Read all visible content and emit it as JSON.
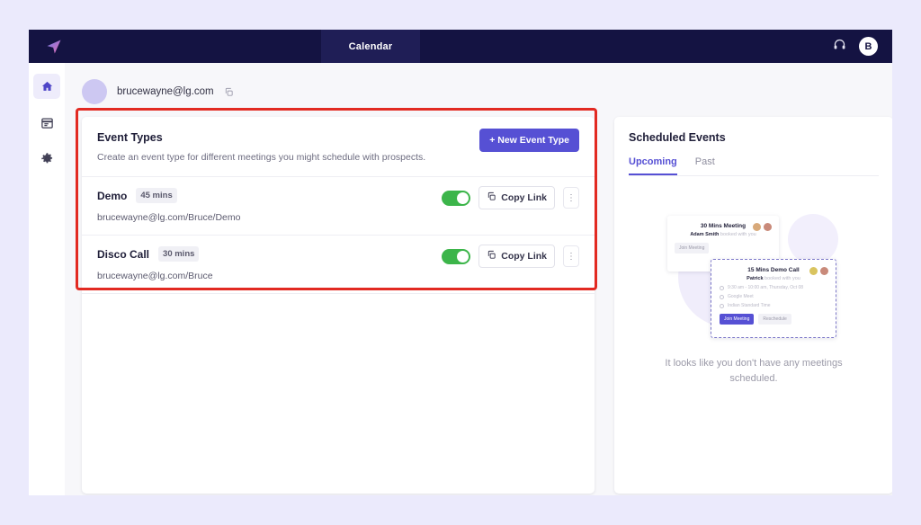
{
  "navbar": {
    "logo_icon": "paper-plane-logo",
    "tabs": [
      {
        "label": "Calendar",
        "active": true
      }
    ],
    "support_icon": "headphones-icon",
    "avatar_initial": "B"
  },
  "sidebar": {
    "items": [
      {
        "icon": "home-icon",
        "active": true
      },
      {
        "icon": "calendar-icon",
        "active": false
      },
      {
        "icon": "gear-icon",
        "active": false
      }
    ]
  },
  "account": {
    "email": "brucewayne@lg.com",
    "copy_icon": "copy-icon"
  },
  "event_types": {
    "title": "Event Types",
    "subtitle": "Create an event type for different meetings you might schedule with prospects.",
    "new_button": "+ New Event Type",
    "copy_link_label": "Copy Link",
    "kebab_icon": "more-vertical-icon",
    "rows": [
      {
        "name": "Demo",
        "duration": "45 mins",
        "link": "brucewayne@lg.com/Bruce/Demo",
        "enabled": true
      },
      {
        "name": "Disco Call",
        "duration": "30 mins",
        "link": "brucewayne@lg.com/Bruce",
        "enabled": true
      }
    ]
  },
  "scheduled_events": {
    "title": "Scheduled Events",
    "tabs": [
      {
        "label": "Upcoming",
        "active": true
      },
      {
        "label": "Past",
        "active": false
      }
    ],
    "empty_message": "It looks like you don't have any meetings scheduled.",
    "illustration": {
      "back_card": {
        "title": "30 Mins Meeting",
        "booker": "Adam Smith",
        "booked_text": " booked with you",
        "button": "Join Meeting"
      },
      "front_card": {
        "title": "15 Mins Demo Call",
        "booker": "Patrick",
        "booked_text": " booked with you",
        "time": "9:30 am - 10:00 am, Thursday, Oct 08",
        "platform": "Google Meet",
        "timezone": "Indian Standard Time",
        "primary_button": "Join Meeting",
        "secondary_button": "Reschedule"
      }
    }
  },
  "annotation": {
    "color": "#e22a22"
  },
  "colors": {
    "navbar": "#141342",
    "accent": "#5650d4",
    "toggle_on": "#3cb54a",
    "page_bg": "#ebeafc"
  }
}
